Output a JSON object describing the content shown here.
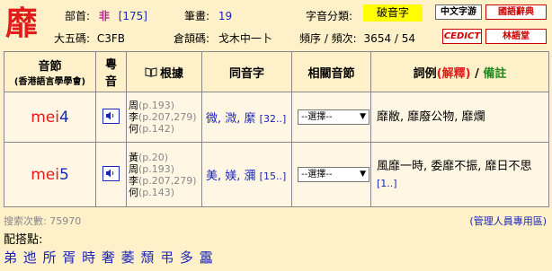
{
  "header": {
    "character": "靡",
    "radical_label": "部首:",
    "radical_value": "非",
    "radical_link": "[175]",
    "strokes_label": "筆畫:",
    "strokes_value": "19",
    "category_label": "字音分類:",
    "category_value": "破音字",
    "wubi_label": "大五碼:",
    "wubi_value": "C3FB",
    "cangjie_label": "倉頡碼:",
    "cangjie_value": "戈木中一卜",
    "freq_label": "頻序 / 頻次:",
    "freq_value": "3654 / 54",
    "buttons": {
      "zhongwen": "中文字游",
      "guoci": "國語辭典",
      "cedict": "CEDICT",
      "lin": "林語堂"
    }
  },
  "table": {
    "headers": {
      "pron": "音節",
      "pron_sub": "(香港語言學學會)",
      "yue": "粵",
      "yue2": "音",
      "source": "根據",
      "homophones": "同音字",
      "related": "相關音節",
      "examples": "詞例",
      "explain": "(解釋)",
      "slash": "/",
      "notes": "備註"
    },
    "rows": [
      {
        "syll_cons": "mei",
        "syll_tone": "4",
        "sources": [
          {
            "name": "周",
            "page": "(p.193)"
          },
          {
            "name": "李",
            "page": "(p.207,279)"
          },
          {
            "name": "何",
            "page": "(p.142)"
          }
        ],
        "homophones": "微, 溦, 縻",
        "homophones_more": "[32..]",
        "select_label": "--選擇--",
        "examples": "靡敝, 靡廢公物, 靡爛",
        "examples_more": ""
      },
      {
        "syll_cons": "mei",
        "syll_tone": "5",
        "sources": [
          {
            "name": "黃",
            "page": "(p.20)"
          },
          {
            "name": "周",
            "page": "(p.193)"
          },
          {
            "name": "李",
            "page": "(p.207,279)"
          },
          {
            "name": "何",
            "page": "(p.143)"
          }
        ],
        "homophones": "美, 媄, 瀰",
        "homophones_more": "[15..]",
        "select_label": "--選擇--",
        "examples": "風靡一時, 委靡不振, 靡日不思",
        "examples_more": "[1..]"
      }
    ]
  },
  "footer": {
    "search_count": "搜索次數: 75970",
    "admin_link": "(管理人員專用區)",
    "match_label": "配搭點:",
    "match_chars": "弟 迆 所 胥 時 奢 萎 頹 弔 多 靁"
  }
}
